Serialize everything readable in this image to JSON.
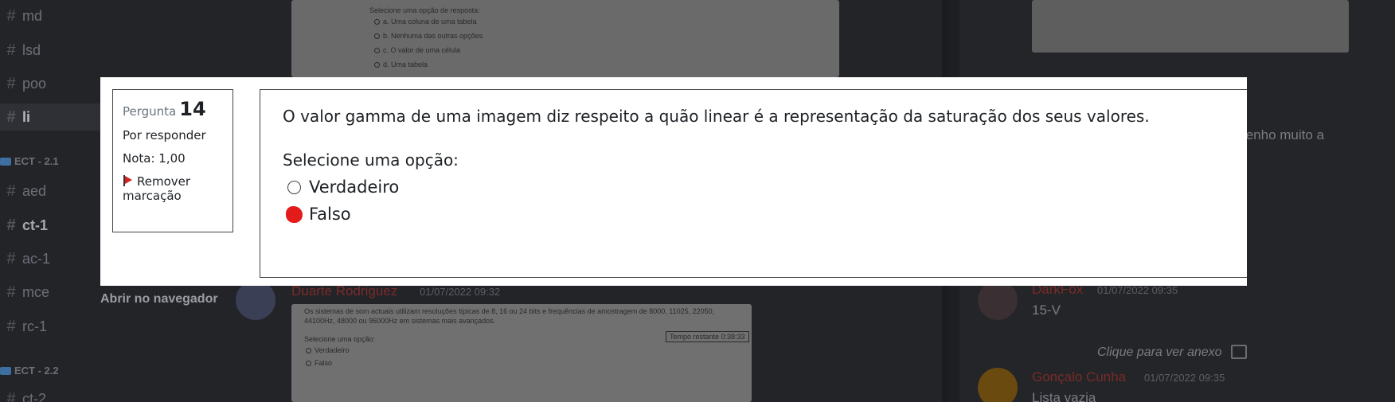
{
  "sidebar": {
    "channels_top": [
      "md",
      "lsd",
      "poo",
      "li"
    ],
    "active_channel": "li",
    "category_1": "ECT - 2.1",
    "channels_mid": [
      "aed",
      "ct-1",
      "ac-1",
      "mce",
      "rc-1"
    ],
    "category_2": "ECT - 2.2",
    "channels_bottom": [
      "ct-2"
    ]
  },
  "chat": {
    "open_in_browser": "Abrir no navegador",
    "top_shot": {
      "prompt": "Selecione uma opção de resposta:",
      "options": [
        "a.   Uma coluna de uma tabela",
        "b.   Nenhuma das outras opções",
        "c.   O valor de uma célula",
        "d.   Uma tabela"
      ]
    },
    "message": {
      "author": "Duarte Rodriguez",
      "time": "01/07/2022 09:32",
      "shot_text": "Os sistemas de som actuais utilizam resoluções típicas de 8, 16 ou 24 bits e frequências de amostragem de 8000, 11025, 22050, 44100Hz, 48000 ou 96000Hz em sistemas mais avançados.",
      "shot_prompt": "Selecione uma opção:",
      "shot_options": [
        "Verdadeiro",
        "Falso"
      ],
      "shot_timer": "Tempo restante 0:38:33"
    }
  },
  "right_panel": {
    "snippet": "tenho muito a",
    "msg1": {
      "author": "DarkFox",
      "time": "01/07/2022 09:35",
      "body": "15-V"
    },
    "attachment": "Clique para ver anexo",
    "msg2": {
      "author": "Gonçalo Cunha",
      "time": "01/07/2022 09:35",
      "body": "Lista vazia"
    }
  },
  "quiz": {
    "question_label": "Pergunta",
    "question_number": "14",
    "status": "Por responder",
    "grade": "Nota: 1,00",
    "flag_action": "Remover marcação",
    "question_text": "O valor gamma de uma imagem diz respeito a quão linear é a representação da saturação dos seus valores.",
    "prompt": "Selecione uma opção:",
    "options": [
      {
        "label": "Verdadeiro",
        "selected": false
      },
      {
        "label": "Falso",
        "selected": true
      }
    ],
    "selected_color": "#e31b1b"
  }
}
